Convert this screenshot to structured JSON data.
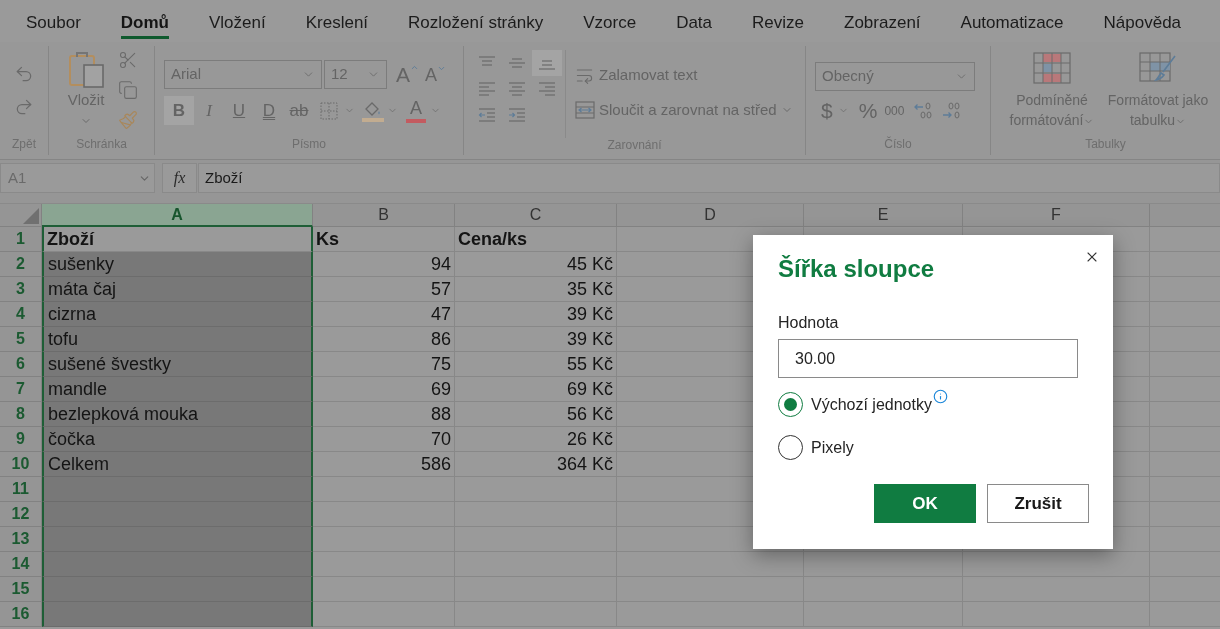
{
  "menu_tabs": [
    {
      "label": "Soubor",
      "selected": false
    },
    {
      "label": "Domů",
      "selected": true
    },
    {
      "label": "Vložení",
      "selected": false
    },
    {
      "label": "Kreslení",
      "selected": false
    },
    {
      "label": "Rozložení stránky",
      "selected": false
    },
    {
      "label": "Vzorce",
      "selected": false
    },
    {
      "label": "Data",
      "selected": false
    },
    {
      "label": "Revize",
      "selected": false
    },
    {
      "label": "Zobrazení",
      "selected": false
    },
    {
      "label": "Automatizace",
      "selected": false
    },
    {
      "label": "Nápověda",
      "selected": false
    }
  ],
  "ribbon": {
    "disabled": true,
    "history": {
      "label": "Zpět"
    },
    "clipboard": {
      "label": "Schránka",
      "paste": "Vložit"
    },
    "font": {
      "label": "Písmo",
      "name": "Arial",
      "size": "12",
      "grow": "A",
      "shrink": "A",
      "styles": [
        {
          "kind": "bold",
          "glyph": "B",
          "selected": true
        },
        {
          "kind": "italic",
          "glyph": "I",
          "selected": false
        },
        {
          "kind": "underline",
          "glyph": "U",
          "selected": false
        },
        {
          "kind": "double_underline",
          "glyph": "D",
          "selected": false
        },
        {
          "kind": "strikethrough",
          "glyph": "ab",
          "selected": false
        }
      ],
      "font_color": "A"
    },
    "alignment": {
      "label": "Zarovnání",
      "buttons": [
        {
          "kind": "top",
          "selected": false
        },
        {
          "kind": "middle",
          "selected": false
        },
        {
          "kind": "bottom",
          "selected": true
        },
        {
          "kind": "left",
          "selected": false
        },
        {
          "kind": "center",
          "selected": false
        },
        {
          "kind": "right",
          "selected": false
        },
        {
          "kind": "outdent",
          "selected": false
        },
        {
          "kind": "indent",
          "selected": false
        }
      ],
      "wrap": "Zalamovat text",
      "merge": "Sloučit a zarovnat na střed"
    },
    "number": {
      "label": "Číslo",
      "format": "Obecný",
      "currency": "$",
      "percent": "%",
      "thousands": "000"
    },
    "tables": {
      "label": "Tabulky",
      "conditional": "Podmíněné formátování",
      "as_table": "Formátovat jako tabulku"
    }
  },
  "formula_bar": {
    "name_box": "A1",
    "function_button": "fx",
    "value": "Zboží"
  },
  "sheet": {
    "columns": [
      {
        "label": "A",
        "selected": true
      },
      {
        "label": "B",
        "selected": false
      },
      {
        "label": "C",
        "selected": false
      },
      {
        "label": "D",
        "selected": false
      },
      {
        "label": "E",
        "selected": false
      },
      {
        "label": "F",
        "selected": false
      }
    ],
    "rows": [
      {
        "number": "1",
        "kind": "header",
        "cells": [
          "Zboží",
          "Ks",
          "Cena/ks"
        ]
      },
      {
        "number": "2",
        "kind": "data",
        "cells": [
          "sušenky",
          "94",
          "45 Kč"
        ]
      },
      {
        "number": "3",
        "kind": "data",
        "cells": [
          "máta čaj",
          "57",
          "35 Kč"
        ]
      },
      {
        "number": "4",
        "kind": "data",
        "cells": [
          "cizrna",
          "47",
          "39 Kč"
        ]
      },
      {
        "number": "5",
        "kind": "data",
        "cells": [
          "tofu",
          "86",
          "39 Kč"
        ]
      },
      {
        "number": "6",
        "kind": "data",
        "cells": [
          "sušené švestky",
          "75",
          "55 Kč"
        ]
      },
      {
        "number": "7",
        "kind": "data",
        "cells": [
          "mandle",
          "69",
          "69 Kč"
        ]
      },
      {
        "number": "8",
        "kind": "data",
        "cells": [
          "bezlepková mouka",
          "88",
          "56 Kč"
        ]
      },
      {
        "number": "9",
        "kind": "data",
        "cells": [
          "čočka",
          "70",
          "26 Kč"
        ]
      },
      {
        "number": "10",
        "kind": "data",
        "cells": [
          "Celkem",
          "586",
          "364 Kč"
        ]
      },
      {
        "number": "11",
        "kind": "data"
      },
      {
        "number": "12",
        "kind": "data"
      },
      {
        "number": "13",
        "kind": "data"
      },
      {
        "number": "14",
        "kind": "data"
      },
      {
        "number": "15",
        "kind": "data"
      },
      {
        "number": "16",
        "kind": "data"
      }
    ]
  },
  "dialog": {
    "title": "Šířka sloupce",
    "field_label": "Hodnota",
    "value": "30.00",
    "options": [
      {
        "label": "Výchozí jednotky",
        "selected": true,
        "info": true
      },
      {
        "label": "Pixely",
        "selected": false,
        "info": false
      }
    ],
    "buttons": [
      {
        "label": "OK",
        "kind": "primary"
      },
      {
        "label": "Zrušit",
        "kind": "secondary"
      }
    ]
  }
}
